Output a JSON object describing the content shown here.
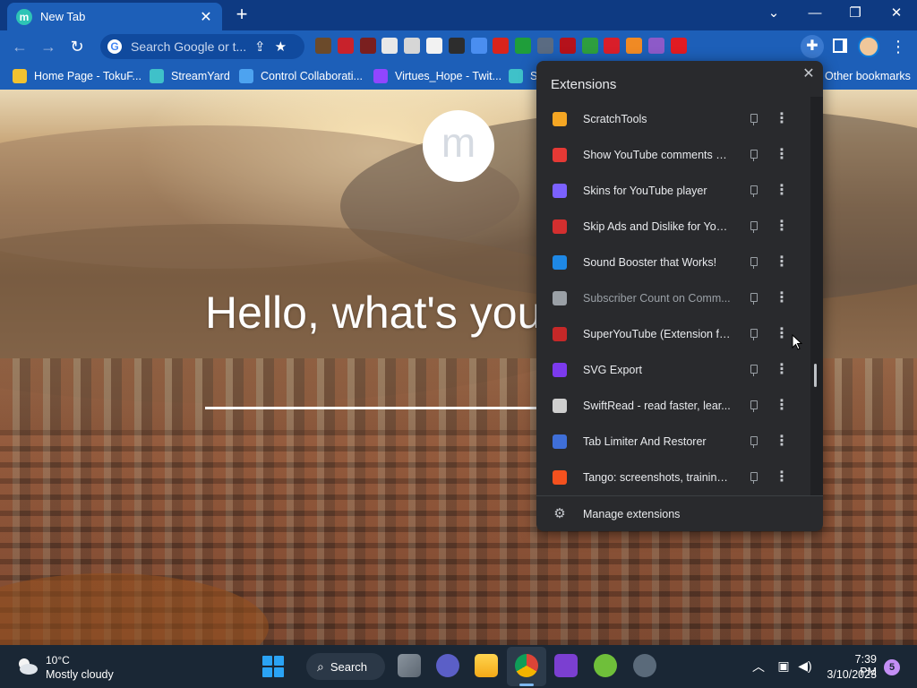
{
  "browser": {
    "tab": {
      "title": "New Tab",
      "favicon_letter": "m"
    },
    "omnibox": {
      "placeholder": "Search Google or t..."
    },
    "toolbar_extension_colors": [
      "#6b4a2a",
      "#c8222b",
      "#7a1f1f",
      "#e8e8e8",
      "#d6d6d6",
      "#f2f2f2",
      "#2d2d2d",
      "#4a8ef0",
      "#d9241c",
      "#1f9e3a",
      "#5a6b82",
      "#b5121b",
      "#2e9e3e",
      "#d91e2a",
      "#f08a24",
      "#8d5ac8",
      "#e01b22"
    ]
  },
  "bookmarks": [
    {
      "label": "Home Page - TokuF...",
      "icon": "tokufest-icon",
      "color": "#f2c230"
    },
    {
      "label": "StreamYard",
      "icon": "streamyard-icon",
      "color": "#3fc1c9"
    },
    {
      "label": "Control Collaborati...",
      "icon": "monitor-icon",
      "color": "#4da3f0"
    },
    {
      "label": "Virtues_Hope - Twit...",
      "icon": "twitch-icon",
      "color": "#9146ff"
    },
    {
      "label": "St",
      "icon": "streamyard-icon",
      "color": "#3fc1c9"
    },
    {
      "label": "Other bookmarks",
      "icon": "folder-icon",
      "color": "#f6d27a"
    }
  ],
  "newtab": {
    "logo_letter": "m",
    "greeting": "Hello, what's you"
  },
  "extensions_menu": {
    "title": "Extensions",
    "items": [
      {
        "name": "ScratchTools",
        "color": "#f5a623",
        "dimmed": false
      },
      {
        "name": "Show YouTube comments w...",
        "color": "#e53935",
        "dimmed": false
      },
      {
        "name": "Skins for YouTube player",
        "color": "#7b61ff",
        "dimmed": false
      },
      {
        "name": "Skip Ads and Dislike for You...",
        "color": "#d32f2f",
        "dimmed": false
      },
      {
        "name": "Sound Booster that Works!",
        "color": "#1e88e5",
        "dimmed": false
      },
      {
        "name": "Subscriber Count on Comm...",
        "color": "#9aa0a6",
        "dimmed": true
      },
      {
        "name": "SuperYouTube (Extension fo...",
        "color": "#c62828",
        "dimmed": false
      },
      {
        "name": "SVG Export",
        "color": "#7c3aed",
        "dimmed": false
      },
      {
        "name": "SwiftRead - read faster, lear...",
        "color": "#cfcfcf",
        "dimmed": false
      },
      {
        "name": "Tab Limiter And Restorer",
        "color": "#3f6fd8",
        "dimmed": false
      },
      {
        "name": "Tango: screenshots, training,...",
        "color": "#f4511e",
        "dimmed": false
      }
    ],
    "footer_label": "Manage extensions"
  },
  "taskbar": {
    "weather": {
      "temp": "10°C",
      "condition": "Mostly cloudy"
    },
    "search_label": "Search",
    "clock": {
      "time": "7:39 PM",
      "date": "3/10/2023"
    },
    "notification_count": "5"
  }
}
